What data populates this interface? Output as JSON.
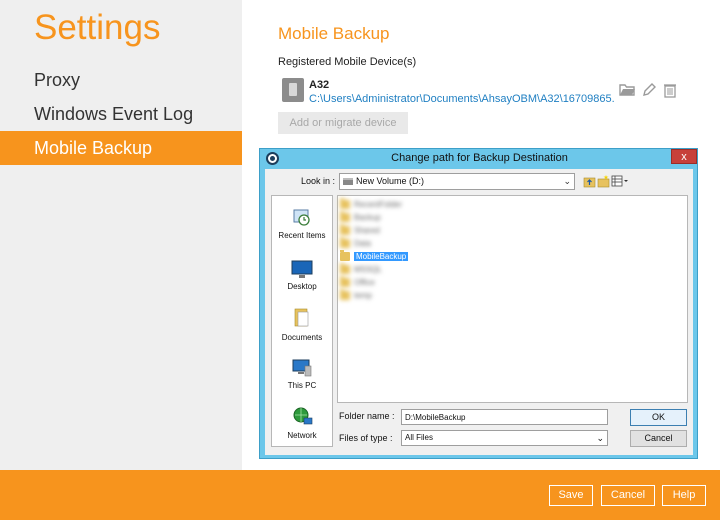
{
  "sidebar": {
    "title": "Settings",
    "items": [
      {
        "label": "Proxy"
      },
      {
        "label": "Windows Event Log"
      },
      {
        "label": "Mobile Backup"
      }
    ]
  },
  "main": {
    "section_title": "Mobile Backup",
    "registered_label": "Registered Mobile Device(s)",
    "device": {
      "name": "A32",
      "path": "C:\\Users\\Administrator\\Documents\\AhsayOBM\\A32\\16709865..."
    },
    "add_device_label": "Add or migrate device"
  },
  "footer": {
    "save_label": "Save",
    "cancel_label": "Cancel",
    "help_label": "Help"
  },
  "dialog": {
    "title": "Change path for Backup Destination",
    "close_label": "x",
    "look_in_label": "Look in :",
    "look_in_value": "New Volume (D:)",
    "places": [
      {
        "label": "Recent Items"
      },
      {
        "label": "Desktop"
      },
      {
        "label": "Documents"
      },
      {
        "label": "This PC"
      },
      {
        "label": "Network"
      }
    ],
    "files": [
      {
        "name": "RecentFolder"
      },
      {
        "name": "Backup"
      },
      {
        "name": "Shared"
      },
      {
        "name": "Data"
      },
      {
        "name": "MobileBackup"
      },
      {
        "name": "MSSQL"
      },
      {
        "name": "Office"
      },
      {
        "name": "temp"
      }
    ],
    "folder_name_label": "Folder name :",
    "folder_name_value": "D:\\MobileBackup",
    "files_of_type_label": "Files of type :",
    "files_of_type_value": "All Files",
    "ok_label": "OK",
    "cancel_label": "Cancel"
  },
  "colors": {
    "accent": "#f7941d",
    "dialog_frame": "#6cc7ea",
    "link": "#1f7fc2"
  }
}
